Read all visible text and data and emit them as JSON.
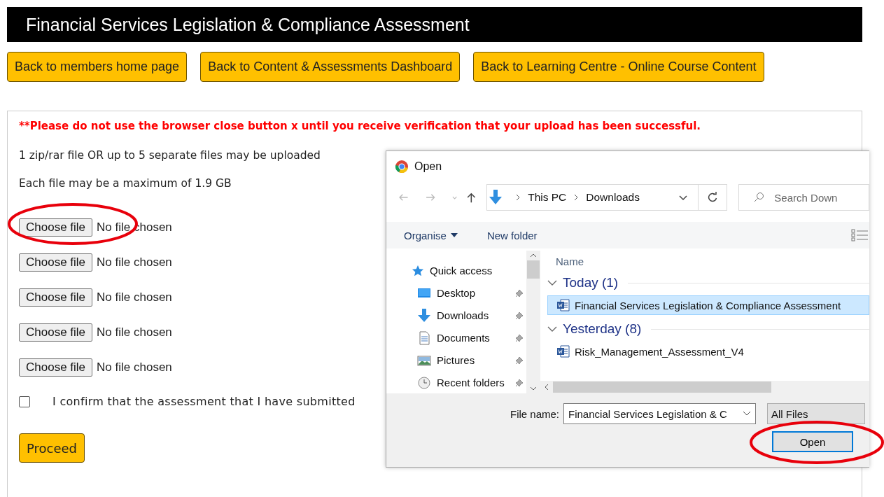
{
  "page_title": "Financial Services Legislation & Compliance Assessment",
  "nav_buttons": [
    "Back to members home page",
    "Back to Content & Assessments Dashboard",
    "Back to Learning Centre  - Online Course Content"
  ],
  "warning": "**Please do not use the browser close button x until you receive verification that your upload has been successful.",
  "info_lines": [
    "1 zip/rar file OR up to 5 separate files may be uploaded",
    "Each file may be a maximum of 1.9 GB"
  ],
  "file_inputs": [
    {
      "button": "Choose file",
      "status": "No file chosen",
      "highlighted": true
    },
    {
      "button": "Choose file",
      "status": "No file chosen",
      "highlighted": false
    },
    {
      "button": "Choose file",
      "status": "No file chosen",
      "highlighted": false
    },
    {
      "button": "Choose file",
      "status": "No file chosen",
      "highlighted": false
    },
    {
      "button": "Choose file",
      "status": "No file chosen",
      "highlighted": false
    }
  ],
  "confirm": {
    "checked": false,
    "label": "I confirm that the assessment that I have submitted"
  },
  "proceed": "Proceed",
  "dialog": {
    "title": "Open",
    "breadcrumb": [
      "This PC",
      "Downloads"
    ],
    "search_placeholder": "Search Down",
    "toolbar": [
      "Organise",
      "New folder"
    ],
    "nav_items": [
      {
        "label": "Quick access",
        "kind": "star",
        "pinned": false
      },
      {
        "label": "Desktop",
        "kind": "desktop",
        "pinned": true
      },
      {
        "label": "Downloads",
        "kind": "download",
        "pinned": true
      },
      {
        "label": "Documents",
        "kind": "document",
        "pinned": true
      },
      {
        "label": "Pictures",
        "kind": "pictures",
        "pinned": true
      },
      {
        "label": "Recent folders",
        "kind": "recent",
        "pinned": true
      }
    ],
    "column": "Name",
    "groups": [
      {
        "label": "Today (1)",
        "expanded": true,
        "files": [
          {
            "name": "Financial Services Legislation & Compliance Assessment",
            "selected": true
          }
        ]
      },
      {
        "label": "Yesterday (8)",
        "expanded": true,
        "files": [
          {
            "name": "Risk_Management_Assessment_V4",
            "selected": false
          }
        ]
      }
    ],
    "file_name_label": "File name:",
    "file_name_value": "Financial Services Legislation & C",
    "file_type": "All Files",
    "open_button": "Open",
    "open_highlighted": true
  }
}
